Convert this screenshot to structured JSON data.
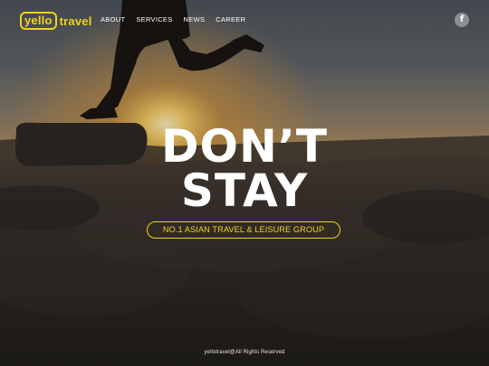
{
  "brand": {
    "logo_boxed": "yello",
    "logo_word": "travel",
    "accent_color": "#f2d21b"
  },
  "nav": {
    "items": [
      {
        "label": "ABOUT"
      },
      {
        "label": "SERVICES"
      },
      {
        "label": "NEWS"
      },
      {
        "label": "CAREER"
      }
    ],
    "social": {
      "icon": "facebook-icon",
      "glyph": "f"
    }
  },
  "hero": {
    "headline_line1": "DON’T",
    "headline_line2": "STAY",
    "tagline": "NO.1 ASIAN TRAVEL & LEISURE GROUP"
  },
  "footer": {
    "copyright": "yellotravel@All Rights Reserved"
  }
}
